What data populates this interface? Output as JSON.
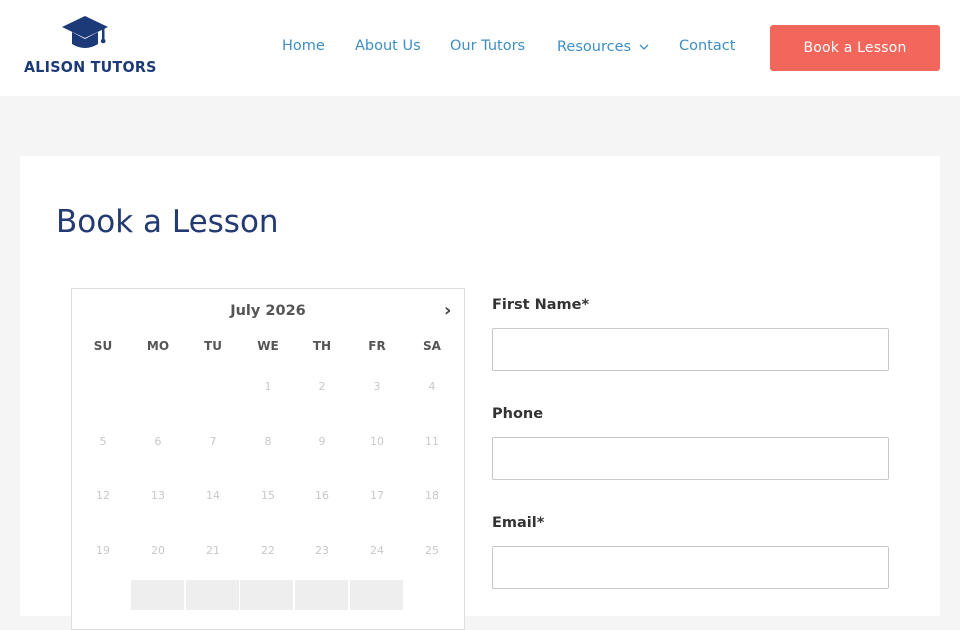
{
  "site": {
    "logo_text": "ALISON TUTORS",
    "brand_color": "#1d3a78",
    "logo_icon": "graduation-cap-icon"
  },
  "nav": {
    "items": [
      {
        "label": "Home"
      },
      {
        "label": "About Us"
      },
      {
        "label": "Our Tutors"
      },
      {
        "label": "Resources",
        "has_dropdown": true
      },
      {
        "label": "Contact"
      }
    ],
    "link_color": "#3d8ec4",
    "cta_label": "Book a Lesson",
    "cta_color": "#f2665b"
  },
  "page": {
    "title": "Book a Lesson",
    "title_color": "#243a73"
  },
  "calendar": {
    "month_label": "July 2026",
    "next_icon": "chevron-right-icon",
    "weekdays": [
      "SU",
      "MO",
      "TU",
      "WE",
      "TH",
      "FR",
      "SA"
    ],
    "weeks": [
      [
        "",
        "",
        "",
        "1",
        "2",
        "3",
        "4"
      ],
      [
        "5",
        "6",
        "7",
        "8",
        "9",
        "10",
        "11"
      ],
      [
        "12",
        "13",
        "14",
        "15",
        "16",
        "17",
        "18"
      ],
      [
        "19",
        "20",
        "21",
        "22",
        "23",
        "24",
        "25"
      ]
    ]
  },
  "form": {
    "fields": [
      {
        "label": "First Name*",
        "value": "",
        "placeholder": ""
      },
      {
        "label": "Phone",
        "value": "",
        "placeholder": ""
      },
      {
        "label": "Email*",
        "value": "",
        "placeholder": ""
      }
    ]
  }
}
